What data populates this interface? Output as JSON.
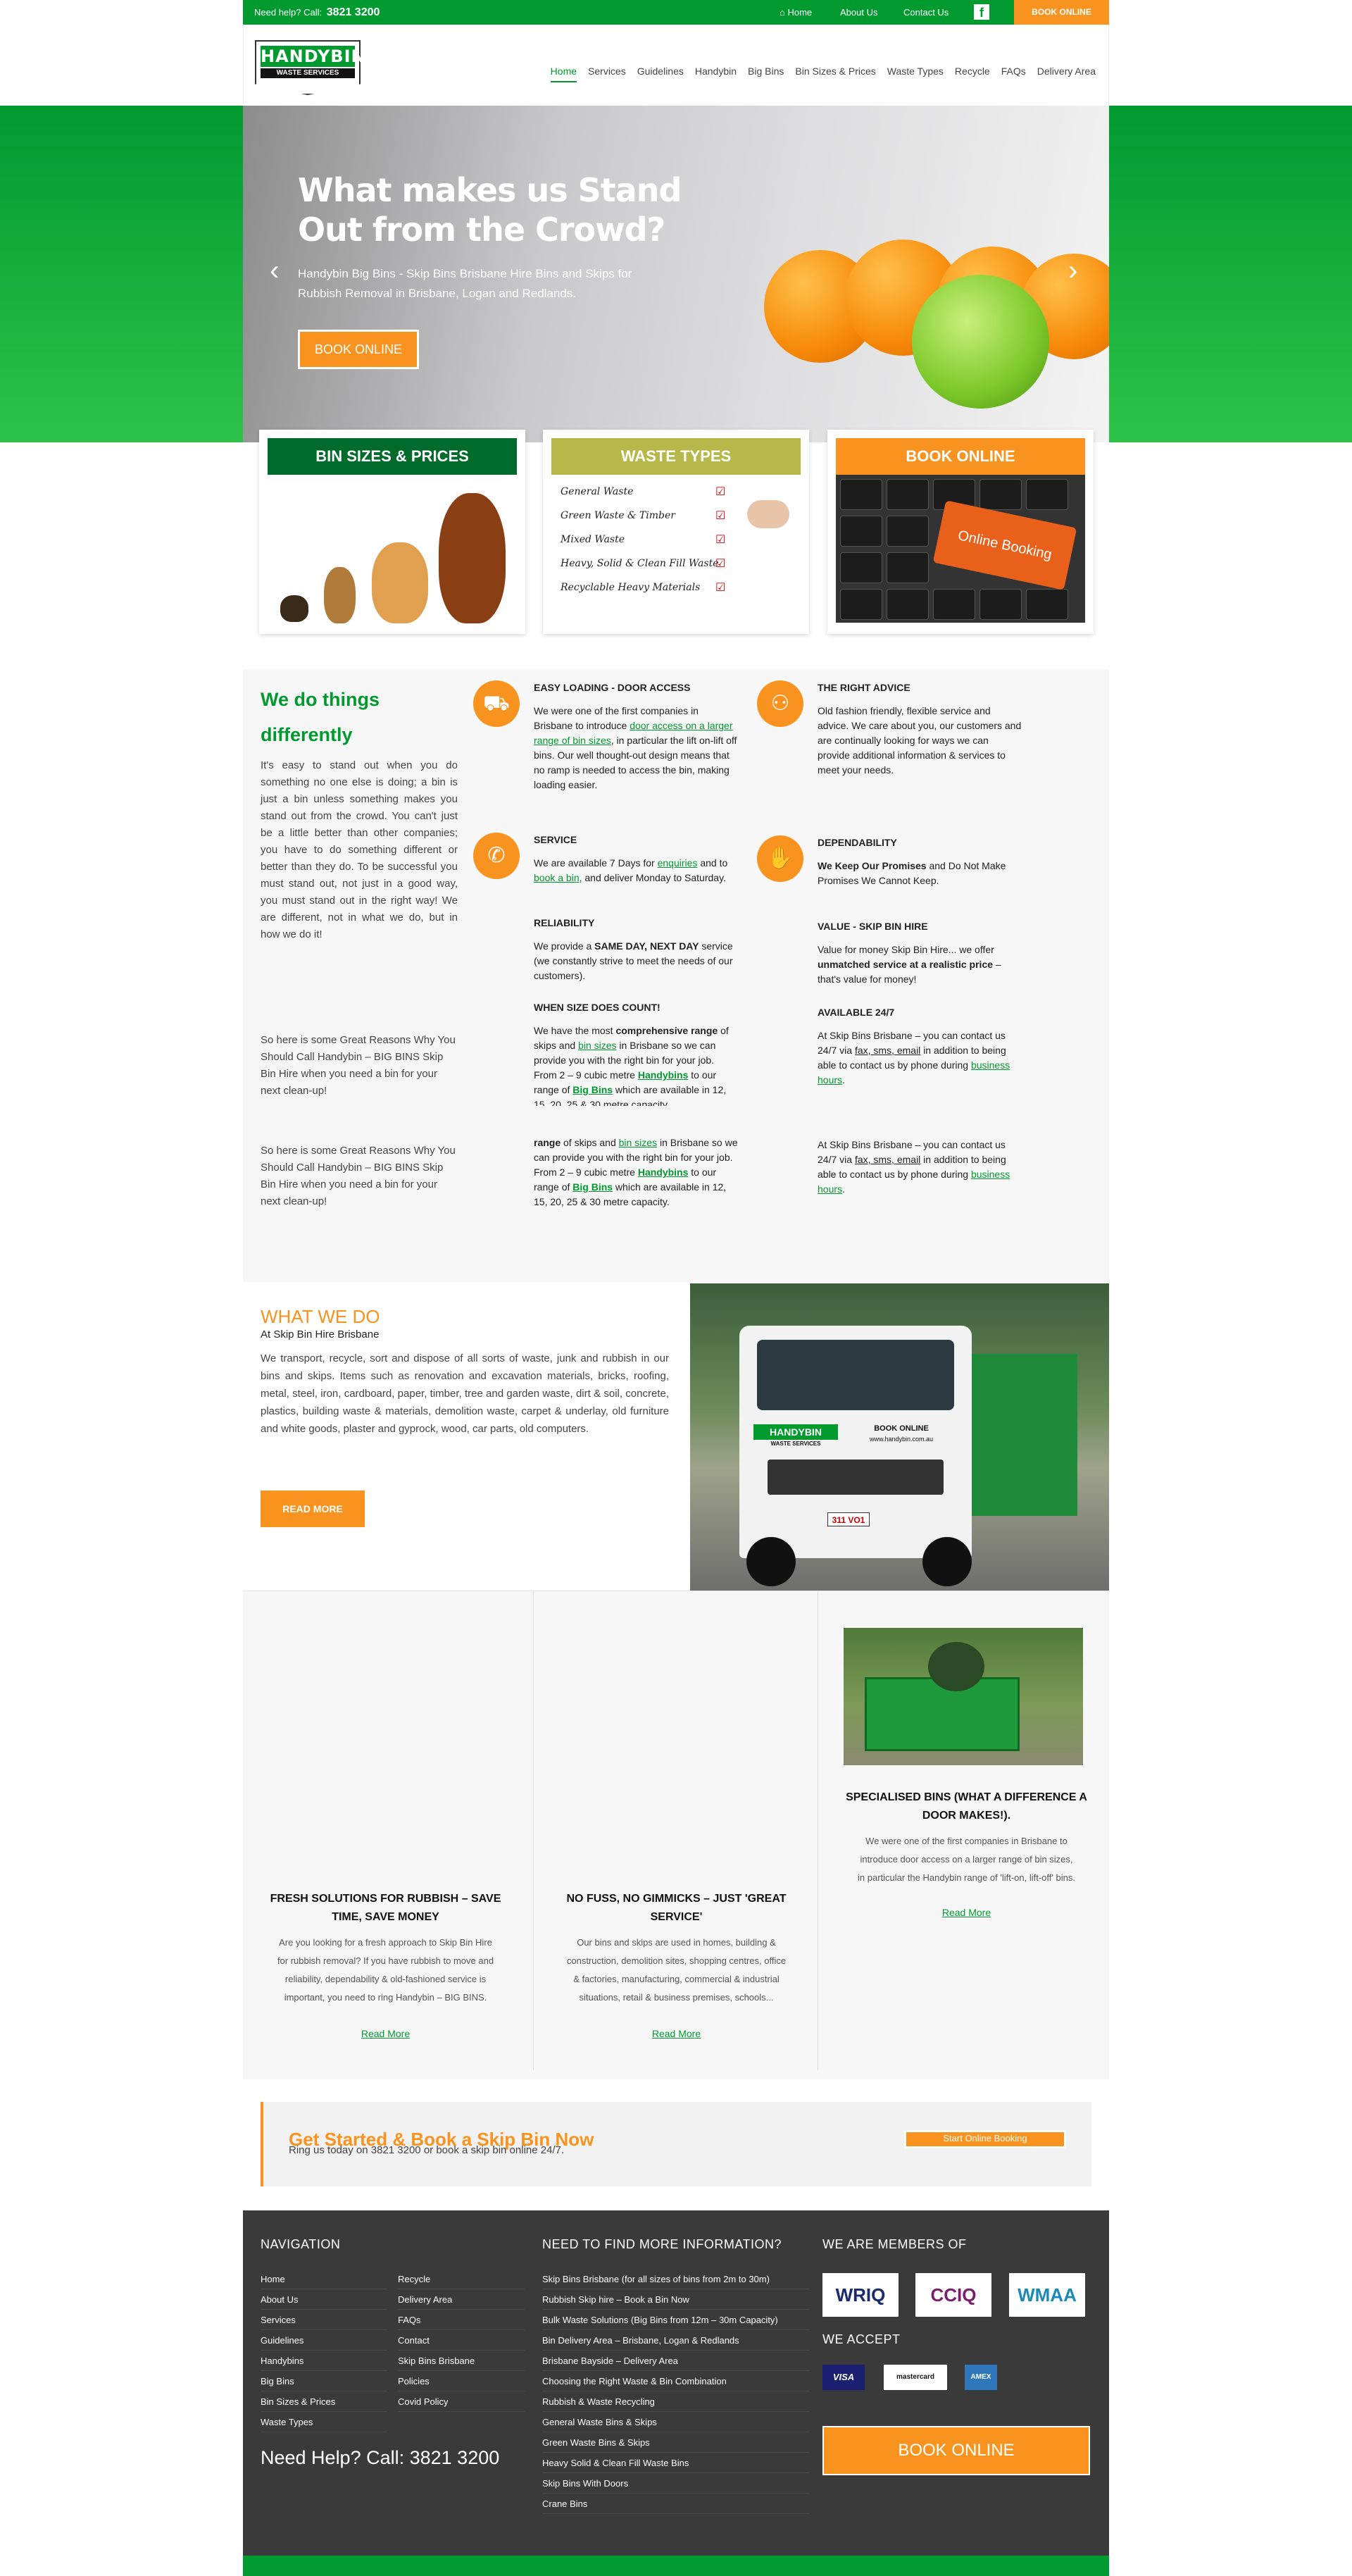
{
  "topbar": {
    "help_label": "Need help? Call:",
    "help_phone": "3821 3200",
    "links": [
      "Home",
      "About Us",
      "Contact Us"
    ],
    "book": "BOOK ONLINE"
  },
  "logo": {
    "title": "HANDYBIN",
    "subtitle": "WASTE SERVICES"
  },
  "nav": [
    "Home",
    "Services",
    "Guidelines",
    "Handybin",
    "Big Bins",
    "Bin Sizes & Prices",
    "Waste Types",
    "Recycle",
    "FAQs",
    "Delivery Area"
  ],
  "hero": {
    "title": "What makes us Stand Out from the Crowd?",
    "text": "Handybin Big Bins - Skip Bins Brisbane Hire Bins and Skips for Rubbish Removal in Brisbane, Logan and Redlands.",
    "button": "BOOK ONLINE",
    "prev": "‹",
    "next": "›"
  },
  "boxes": [
    {
      "title": "BIN SIZES & PRICES",
      "color": "#006b2b"
    },
    {
      "title": "WASTE TYPES",
      "color": "#b8b84a",
      "items": [
        "General Waste",
        "Green Waste & Timber",
        "Mixed Waste",
        "Heavy, Solid & Clean Fill Waste",
        "Recyclable Heavy Materials"
      ]
    },
    {
      "title": "BOOK ONLINE",
      "color": "#f7931e",
      "key_label": "Online Booking"
    }
  ],
  "diff": {
    "heading": "We do things differently",
    "p1": "It's easy to stand out when you do something no one else is doing; a bin is just a bin unless something makes you stand out from the crowd. You can't just be a little better than other companies; you have to do something different or better than they do. To be successful you must stand out, not just in a good way, you must stand out in the right way! We are different, not in what we do, but in how we do it!",
    "p2": "So here is some Great Reasons Why You Should Call Handybin – BIG BINS Skip Bin Hire when you need a bin for your next clean-up!",
    "p3": "So here is some Great Reasons Why You Should Call Handybin – BIG BINS Skip Bin Hire when you need a bin for your next clean-up!",
    "easy_title": "EASY LOADING - DOOR ACCESS",
    "easy_a": "We were one of the first companies in Brisbane to introduce ",
    "easy_link": "door access on a larger range of bin sizes",
    "easy_b": ", in particular the lift on-lift off bins. Our well thought-out design means that no ramp is needed to access the bin, making loading easier.",
    "service_title": "SERVICE",
    "service_a": "We are available 7 Days for ",
    "service_link1": "enquiries",
    "service_b": " and to ",
    "service_link2": "book a bin",
    "service_c": ", and deliver Monday to Saturday.",
    "rel_title": "RELIABILITY",
    "rel_a": "We provide a ",
    "rel_bold": "SAME DAY, NEXT DAY",
    "rel_b": " service (we constantly strive to meet the needs of our customers).",
    "size_title": "WHEN SIZE DOES COUNT!",
    "size_a": "We have the most ",
    "size_bold": "comprehensive range",
    "size_b": " of skips and ",
    "size_link1": "bin sizes",
    "size_c": " in Brisbane so we can provide you with the right bin for your job. From 2 – 9 cubic metre ",
    "size_link2": "Handybins",
    "size_d": " to our range of ",
    "size_link3": "Big Bins",
    "size_e": " which are available in 12, 15, 20, 25 & 30 metre capacity.",
    "size_dup_a": "We have the most comprehensive",
    "size_dup_b": "range",
    "advice_title": "THE RIGHT ADVICE",
    "advice": "Old fashion friendly, flexible service and advice. We care about you, our customers and are continually looking for ways we can provide additional information & services to meet your needs.",
    "dep_title": "DEPENDABILITY",
    "dep_bold": "We Keep Our Promises",
    "dep_b": " and Do Not Make Promises We Cannot Keep.",
    "value_title": "VALUE - SKIP BIN HIRE",
    "value_a": "Value for money Skip Bin Hire... we offer ",
    "value_bold": "unmatched service at a realistic price",
    "value_b": " – that's value for money!",
    "avail_title": "AVAILABLE 24/7",
    "avail_a": "At Skip Bins Brisbane – you can contact us 24/7 via ",
    "avail_link1": "fax, sms, email",
    "avail_b": " in addition to being able to contact us by phone during ",
    "avail_link2": "business hours",
    "avail_c": "."
  },
  "whatwedo": {
    "title": "WHAT WE DO",
    "subtitle": "At Skip Bin Hire Brisbane",
    "text": "We transport, recycle, sort and dispose of all sorts of waste, junk and rubbish in our bins and skips. Items such as renovation and excavation materials, bricks, roofing, metal, steel, iron, cardboard, paper, timber, tree and garden waste, dirt & soil, concrete, plastics, building waste & materials, demolition waste, carpet & underlay, old furniture and white goods, plaster and gyprock, wood, car parts, old computers.",
    "button": "READ MORE",
    "truck_brand": "HANDYBIN",
    "truck_sub": "WASTE SERVICES",
    "truck_book": "BOOK ONLINE",
    "truck_web": "www.handybin.com.au",
    "plate": "311 VO1"
  },
  "columns": [
    {
      "title": "FRESH SOLUTIONS FOR RUBBISH – SAVE TIME, SAVE MONEY",
      "text": "Are you looking for a fresh approach to Skip Bin Hire for rubbish removal? If you have rubbish to move and reliability, dependability & old-fashioned service is important, you need to ring Handybin – BIG BINS.",
      "link": "Read More"
    },
    {
      "title": "NO FUSS, NO GIMMICKS – JUST 'GREAT SERVICE'",
      "text": "Our bins and skips are used in homes, building & construction, demolition sites, shopping centres, office & factories, manufacturing, commercial & industrial situations, retail & business premises, schools...",
      "link": "Read More"
    },
    {
      "title": "SPECIALISED BINS (WHAT A DIFFERENCE A DOOR MAKES!).",
      "text": "We were one of the first companies in Brisbane to introduce door access on a larger range of bin sizes, in particular the Handybin range of 'lift-on, lift-off' bins.",
      "link": "Read More"
    }
  ],
  "cta": {
    "title": "Get Started & Book a Skip Bin Now",
    "text": "Ring us today on 3821 3200 or book a skip bin online 24/7.",
    "button": "Start Online Booking"
  },
  "footer": {
    "nav_title": "NAVIGATION",
    "nav_left": [
      "Home",
      "About Us",
      "Services",
      "Guidelines",
      "Handybins",
      "Big Bins",
      "Bin Sizes & Prices",
      "Waste Types"
    ],
    "nav_right": [
      "Recycle",
      "Delivery Area",
      "FAQs",
      "Contact",
      "Skip Bins Brisbane",
      "Policies",
      "Covid Policy"
    ],
    "help": "Need Help? Call: 3821 3200",
    "info_title": "NEED TO FIND MORE INFORMATION?",
    "info_links": [
      "Skip Bins Brisbane (for all sizes of bins from 2m to 30m)",
      "Rubbish Skip hire – Book a Bin Now",
      "Bulk Waste Solutions (Big Bins from 12m – 30m Capacity)",
      "Bin Delivery Area – Brisbane, Logan & Redlands",
      "Brisbane Bayside – Delivery Area",
      "Choosing the Right Waste & Bin Combination",
      "Rubbish & Waste Recycling",
      "General Waste Bins & Skips",
      "Green Waste Bins & Skips",
      "Heavy Solid & Clean Fill Waste Bins",
      "Skip Bins With Doors",
      "Crane Bins"
    ],
    "members_title": "WE ARE MEMBERS OF",
    "members": [
      "WRIQ",
      "CCIQ",
      "WMAA"
    ],
    "accept_title": "WE ACCEPT",
    "cards": [
      "VISA",
      "mastercard",
      "AMEX"
    ],
    "book": "BOOK ONLINE"
  }
}
